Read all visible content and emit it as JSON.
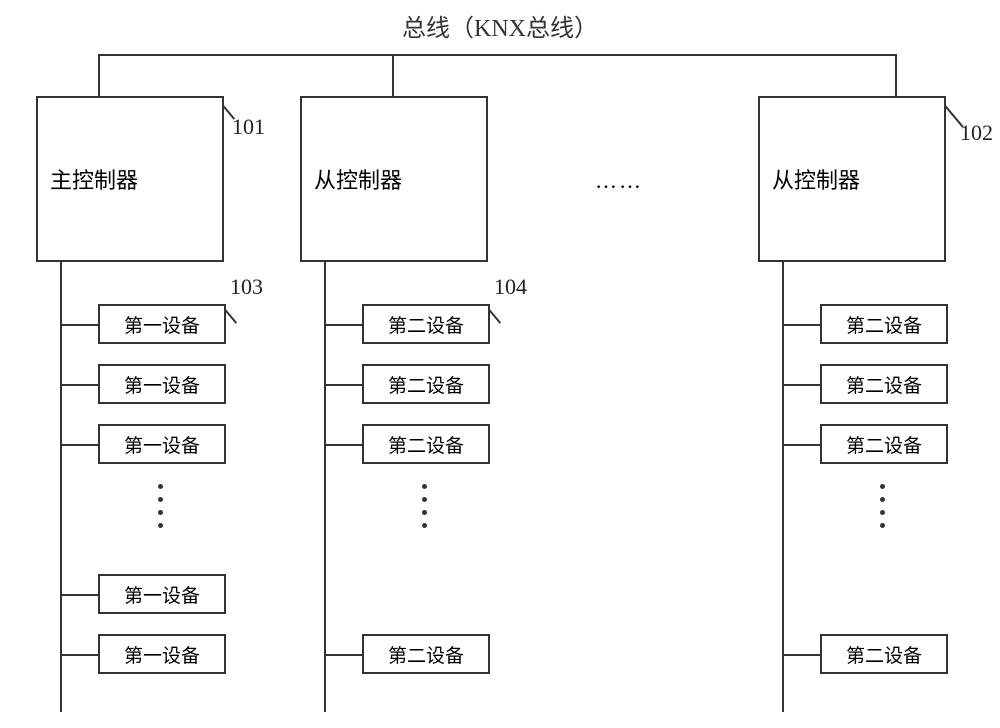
{
  "title": "总线（KNX总线）",
  "controllers": {
    "main": {
      "label": "主控制器",
      "tag": "101"
    },
    "slave1": {
      "label": "从控制器"
    },
    "slave2": {
      "label": "从控制器",
      "tag": "102"
    }
  },
  "ellipsis": "……",
  "tags": {
    "device1": "103",
    "device2": "104"
  },
  "devices": {
    "col1": [
      "第一设备",
      "第一设备",
      "第一设备",
      "第一设备",
      "第一设备"
    ],
    "col2": [
      "第二设备",
      "第二设备",
      "第二设备",
      "第二设备"
    ],
    "col3": [
      "第二设备",
      "第二设备",
      "第二设备",
      "第二设备"
    ]
  },
  "chart_data": {
    "type": "diagram",
    "title": "总线（KNX总线）",
    "bus": "KNX",
    "nodes": [
      {
        "id": "101",
        "role": "主控制器",
        "children_label": "第一设备",
        "children_count_shown": 5,
        "children_tag": "103"
      },
      {
        "id": "slave-a",
        "role": "从控制器",
        "children_label": "第二设备",
        "children_count_shown": 4,
        "children_tag": "104"
      },
      {
        "id": "102",
        "role": "从控制器",
        "children_label": "第二设备",
        "children_count_shown": 4
      }
    ],
    "notes": "Ellipses indicate additional slave controllers on the bus and additional devices under each controller."
  }
}
